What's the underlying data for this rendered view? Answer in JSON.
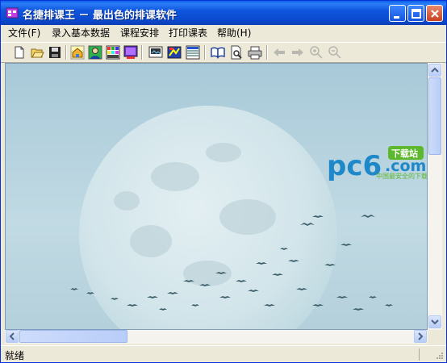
{
  "window": {
    "title": "名捷排课王 － 最出色的排课软件"
  },
  "menu": {
    "items": [
      "文件(F)",
      "录入基本数据",
      "课程安排",
      "打印课表",
      "帮助(H)"
    ]
  },
  "toolbar": {
    "icons": [
      "new-icon",
      "open-icon",
      "save-icon",
      "home-icon",
      "teacher-icon",
      "class-icon",
      "course-icon",
      "room-icon",
      "arrange-icon",
      "timetable-icon",
      "book-icon",
      "preview-icon",
      "print-icon",
      "back-icon",
      "forward-icon",
      "zoom-in-icon",
      "zoom-out-icon"
    ]
  },
  "watermark": {
    "brand_main": "pc6",
    "brand_suffix": ".com",
    "badge": "下载站",
    "tagline": "中国最安全的下载站"
  },
  "status": {
    "text": "就绪"
  },
  "colors": {
    "titlebar": "#0a49cf",
    "chrome": "#ece9d8",
    "sky": "#b9d6e3",
    "brand_blue": "#1e88c8",
    "brand_green": "#5cb82c"
  }
}
